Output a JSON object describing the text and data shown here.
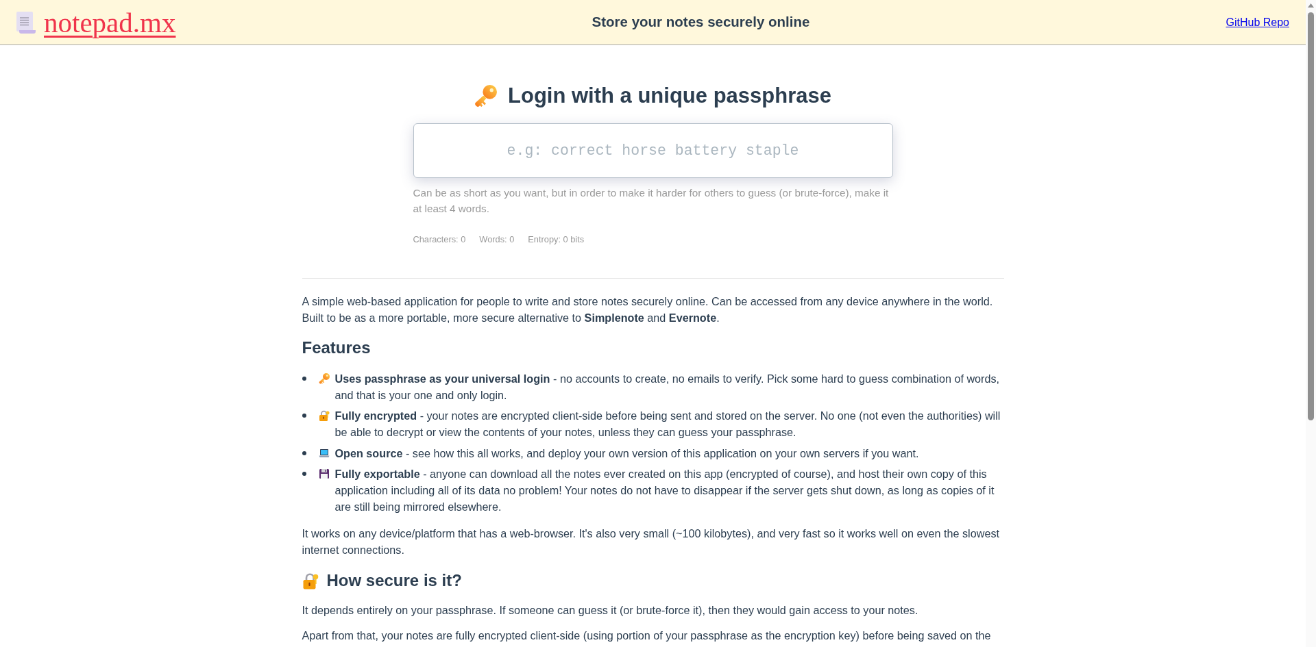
{
  "header": {
    "logo": "notepad.mx",
    "tagline": "Store your notes securely online",
    "link": "GitHub Repo"
  },
  "login": {
    "title": "Login with a unique passphrase",
    "passphrase": {
      "placeholder": "e.g: correct horse battery staple"
    },
    "hint": "Can be as short as you want, but in order to make it harder for others to guess (or brute-force), make it at least 4 words.",
    "stats": [
      "Characters: 0",
      "Words: 0",
      "Entropy: 0 bits"
    ]
  },
  "about": {
    "intro": "A simple web-based application for people to write and store notes securely online. Can be accessed from any device anywhere in the world. Built to be as a more portable, more secure alternative to **Simplenote** and **Evernote**.",
    "features_heading": "Features",
    "features": [
      "**Uses passphrase as your universal login** - no accounts to create, no emails to verify. Pick some hard to guess combination of words, and that is your one and only login.",
      "**Fully encrypted** - your notes are encrypted client-side before being sent and stored on the server. No one (not even the authorities) will be able to decrypt or view the contents of your notes, unless they can guess your passphrase.",
      "**Open source** - see how this all works, and deploy your own version of this application on your own servers if you want.",
      "**Fully exportable** - anyone can download all the notes ever created on this app (encrypted of course), and host their own copy of this application including all of its data no problem! Your notes do not have to disappear if the server gets shut down, as long as copies of it are still being mirrored elsewhere."
    ],
    "platform_note": "It works on any device/platform that has a web-browser. It's also very small (~100 kilobytes), and very fast so it works well on even the slowest internet connections.",
    "security_heading": "How secure is it?",
    "security_paragraphs": [
      "It depends entirely on your passphrase. If someone can guess it (or brute-force it), then they would gain access to your notes.",
      "Apart from that, your notes are fully encrypted client-side (using portion of your passphrase as the encryption key) before being saved on the"
    ]
  }
}
